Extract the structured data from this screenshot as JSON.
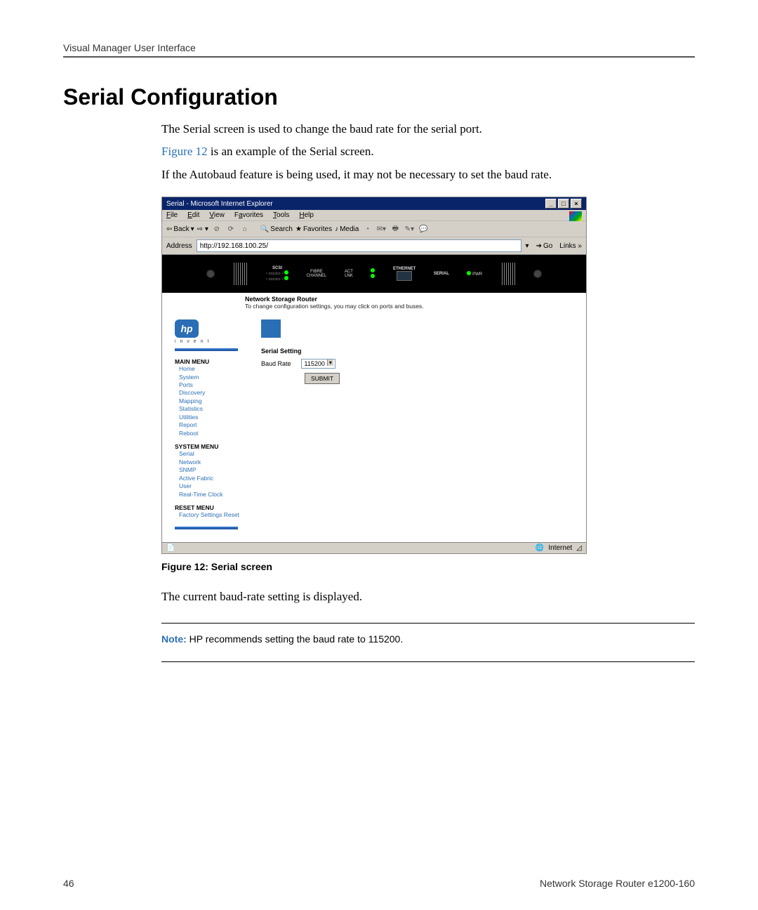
{
  "section_header": "Visual Manager User Interface",
  "heading": "Serial Configuration",
  "para1": "The Serial screen is used to change the baud rate for the serial port.",
  "para2_link": "Figure 12",
  "para2_rest": " is an example of the Serial screen.",
  "para3": "If the Autobaud feature is being used, it may not be necessary to set the baud rate.",
  "caption": "Figure 12:  Serial screen",
  "after_caption": "The current baud-rate setting is displayed.",
  "note_label": "Note:",
  "note_text": "  HP recommends setting the baud rate to 115200.",
  "footer_page": "46",
  "footer_product": "Network Storage Router e1200-160",
  "ie": {
    "title": "Serial - Microsoft Internet Explorer",
    "menus": [
      "File",
      "Edit",
      "View",
      "Favorites",
      "Tools",
      "Help"
    ],
    "tb_back": "Back",
    "tb_search": "Search",
    "tb_fav": "Favorites",
    "tb_media": "Media",
    "addr_label": "Address",
    "addr_value": "http://192.168.100.25/",
    "go_label": "Go",
    "links_label": "Links",
    "router_title": "Network Storage Router",
    "router_sub": "To change configuration settings, you may click on ports and buses.",
    "invent_label": "i n v e n t",
    "router_labels": {
      "scsi": "SCSI",
      "fibre": "FIBRE\nCHANNEL",
      "act": "ACT\nLNK",
      "eth": "ETHERNET",
      "serial": "SERIAL",
      "pwr": "PWR"
    },
    "menu": {
      "main_title": "MAIN MENU",
      "main_items": [
        "Home",
        "System",
        "Ports",
        "Discovery",
        "Mapping",
        "Statistics",
        "Utilities",
        "Report",
        "Reboot"
      ],
      "sys_title": "SYSTEM MENU",
      "sys_items": [
        "Serial",
        "Network",
        "SNMP",
        "Active Fabric",
        "User",
        "Real-Time Clock"
      ],
      "reset_title": "RESET MENU",
      "reset_items": [
        "Factory Settings Reset"
      ]
    },
    "form": {
      "title": "Serial Setting",
      "field_label": "Baud Rate",
      "field_value": "115200",
      "submit": "SUBMIT"
    },
    "status_zone": "Internet"
  }
}
